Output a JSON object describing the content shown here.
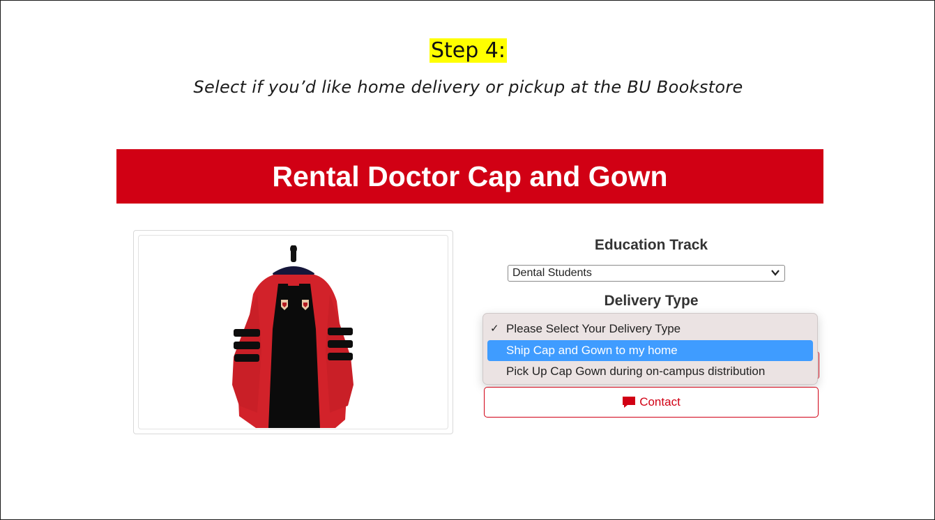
{
  "step": {
    "title": "Step 4:",
    "subtitle": "Select if you’d like home delivery or pickup at the BU Bookstore"
  },
  "product": {
    "title": "Rental Doctor Cap and Gown",
    "image_icon": "doctoral-gown-image"
  },
  "education_track": {
    "label": "Education Track",
    "selected": "Dental Students"
  },
  "delivery_type": {
    "label": "Delivery Type",
    "options": [
      {
        "label": "Please Select Your Delivery Type",
        "checked": true
      },
      {
        "label": "Ship Cap and Gown to my home",
        "highlighted": true
      },
      {
        "label": "Pick Up Cap Gown during on-campus distribution"
      }
    ]
  },
  "contact": {
    "label": "Contact",
    "icon": "comment-icon"
  },
  "colors": {
    "brand_red": "#d10014",
    "highlight_yellow": "#ffff00",
    "selection_blue": "#3f9cff"
  }
}
